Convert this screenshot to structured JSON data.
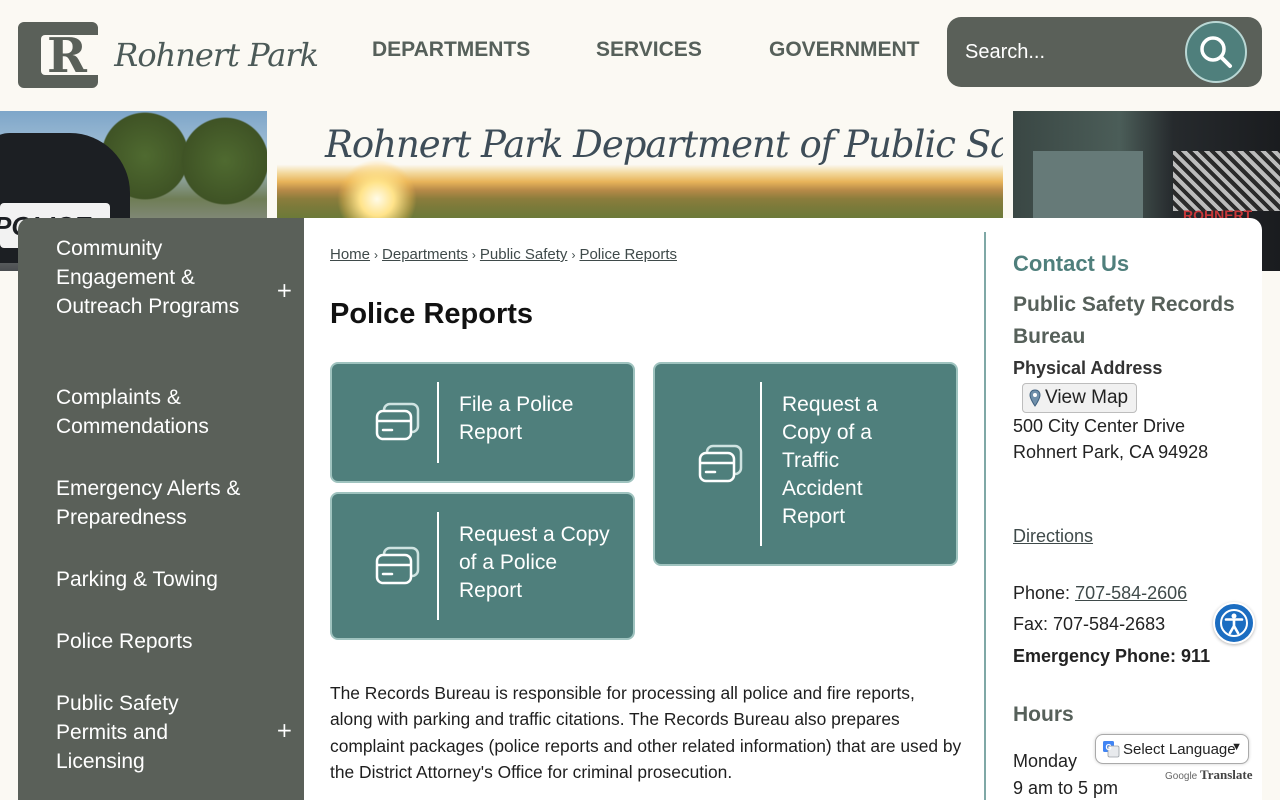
{
  "header": {
    "logo_letter": "R",
    "logo_text": "Rohnert Park",
    "nav": [
      "DEPARTMENTS",
      "SERVICES",
      "GOVERNMENT"
    ],
    "search_placeholder": "Search..."
  },
  "banner": {
    "title": "Rohnert Park Department of Public Safety",
    "left_car_text": "POLICE",
    "right_truck_text": "ROHNERT PARK"
  },
  "sidebar": {
    "items": [
      {
        "label": "Community Engagement & Outreach Programs",
        "expandable": true
      },
      {
        "label": "Complaints & Commendations",
        "expandable": false
      },
      {
        "label": "Emergency Alerts & Preparedness",
        "expandable": false
      },
      {
        "label": "Parking & Towing",
        "expandable": false
      },
      {
        "label": "Police Reports",
        "expandable": false
      },
      {
        "label": "Public Safety Permits and Licensing",
        "expandable": true
      }
    ],
    "expand_symbol": "+"
  },
  "breadcrumb": [
    "Home",
    "Departments",
    "Public Safety",
    "Police Reports"
  ],
  "breadcrumb_sep": "›",
  "page_title": "Police Reports",
  "tiles": [
    {
      "label": "File a Police Report"
    },
    {
      "label": "Request a Copy of a Traffic Accident Report"
    },
    {
      "label": "Request a Copy of a Police Report"
    }
  ],
  "body_text": "The Records Bureau is responsible for processing all police and fire reports, along with parking and traffic citations. The Records Bureau also prepares complaint packages (police reports and other related information) that are used by the District Attorney's Office for criminal prosecution.",
  "contact": {
    "heading": "Contact Us",
    "department": "Public Safety Records Bureau",
    "address_label": "Physical Address",
    "map_button": "View Map",
    "address_line1": "500 City Center Drive",
    "address_line2": "Rohnert Park, CA 94928",
    "directions": "Directions",
    "phone_label": "Phone: ",
    "phone": "707-584-2606",
    "fax": "Fax: 707-584-2683",
    "emergency": "Emergency Phone: 911",
    "hours_heading": "Hours",
    "hours_day": "Monday",
    "hours_time": "9 am to 5 pm"
  },
  "translate": {
    "select_label": "Select Language",
    "powered_by": "Google",
    "translate_word": "Translate"
  },
  "colors": {
    "accent_teal": "#4f7f7c",
    "sidebar_gray": "#5a6059",
    "background": "#fbf9f3"
  }
}
